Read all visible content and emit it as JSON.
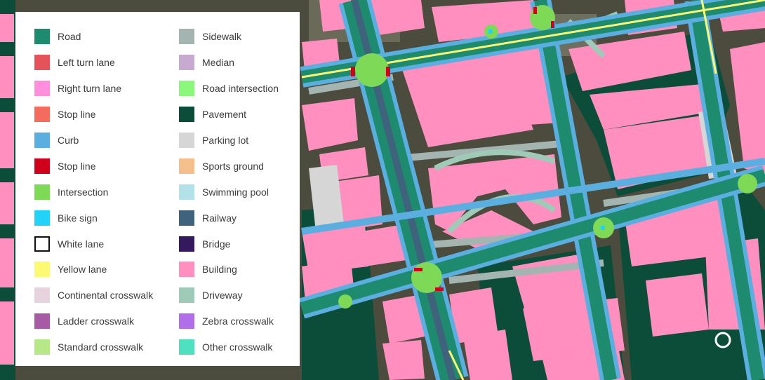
{
  "legend": {
    "left": [
      {
        "label": "Road",
        "color": "#1e8a6e"
      },
      {
        "label": "Left turn lane",
        "color": "#e5525a"
      },
      {
        "label": "Right turn lane",
        "color": "#ff8fdc"
      },
      {
        "label": "Stop line",
        "color": "#f46c5e"
      },
      {
        "label": "Curb",
        "color": "#5aaee0"
      },
      {
        "label": "Stop line",
        "color": "#d0021b"
      },
      {
        "label": "Intersection",
        "color": "#7ed957"
      },
      {
        "label": "Bike sign",
        "color": "#22d3f7"
      },
      {
        "label": "White lane",
        "color": "#ffffff",
        "outline": true
      },
      {
        "label": "Yellow lane",
        "color": "#fbfa72"
      },
      {
        "label": "Continental crosswalk",
        "color": "#e6d3de"
      },
      {
        "label": "Ladder crosswalk",
        "color": "#a65ba4"
      },
      {
        "label": "Standard crosswalk",
        "color": "#b6e888"
      }
    ],
    "right": [
      {
        "label": "Sidewalk",
        "color": "#a4b4b0"
      },
      {
        "label": "Median",
        "color": "#c8a9d0"
      },
      {
        "label": "Road intersection",
        "color": "#8bf77c"
      },
      {
        "label": "Pavement",
        "color": "#0c4d3a"
      },
      {
        "label": "Parking lot",
        "color": "#d6d6d6"
      },
      {
        "label": "Sports ground",
        "color": "#f5bf8c"
      },
      {
        "label": "Swimming pool",
        "color": "#b3e1e8"
      },
      {
        "label": "Railway",
        "color": "#3f637d"
      },
      {
        "label": "Bridge",
        "color": "#35195f"
      },
      {
        "label": "Building",
        "color": "#ff8fbf"
      },
      {
        "label": "Driveway",
        "color": "#9fcab8"
      },
      {
        "label": "Zebra crosswalk",
        "color": "#b26ee8"
      },
      {
        "label": "Other crosswalk",
        "color": "#4fe0bf"
      }
    ]
  }
}
